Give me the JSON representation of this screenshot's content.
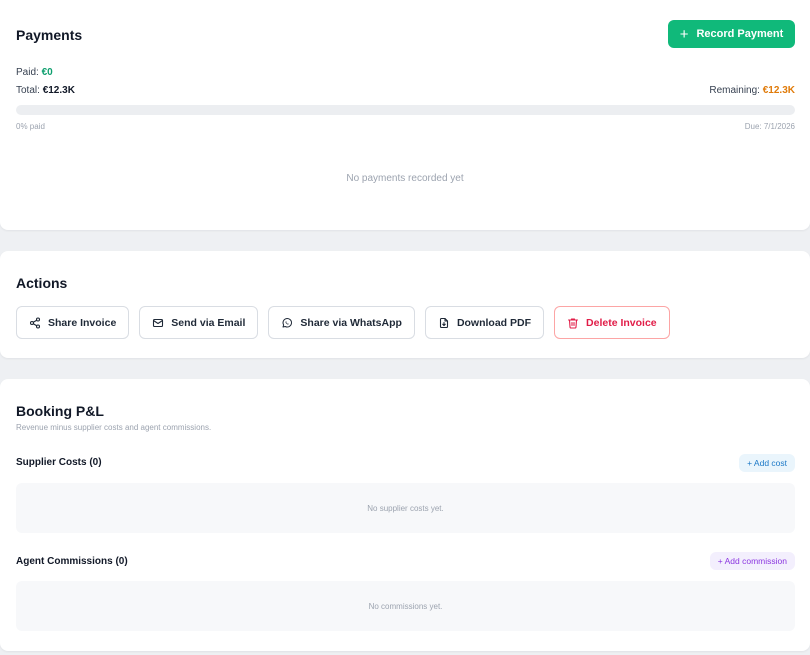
{
  "payments": {
    "title": "Payments",
    "record_button_label": "Record Payment",
    "paid_label": "Paid:",
    "paid_value": "€0",
    "total_label": "Total:",
    "total_value": "€12.3K",
    "remaining_label": "Remaining:",
    "remaining_value": "€12.3K",
    "progress_fraction": 0,
    "percent_paid_text": "0% paid",
    "due_text": "Due: 7/1/2026",
    "empty_text": "No payments recorded yet"
  },
  "actions": {
    "title": "Actions",
    "buttons": [
      {
        "label": "Share Invoice",
        "icon": "share-icon"
      },
      {
        "label": "Send via Email",
        "icon": "mail-icon"
      },
      {
        "label": "Share via WhatsApp",
        "icon": "whatsapp-icon"
      },
      {
        "label": "Download PDF",
        "icon": "file-download-icon"
      },
      {
        "label": "Delete Invoice",
        "icon": "trash-icon"
      }
    ]
  },
  "pnl": {
    "title": "Booking P&L",
    "subtitle": "Revenue minus supplier costs and agent commissions.",
    "supplier": {
      "heading": "Supplier Costs (0)",
      "add_label": "+ Add cost",
      "empty_text": "No supplier costs yet."
    },
    "commissions": {
      "heading": "Agent Commissions (0)",
      "add_label": "+ Add commission",
      "empty_text": "No commissions yet."
    }
  },
  "colors": {
    "primary_green": "#10b97a",
    "remaining_orange": "#e07b0a",
    "danger_red": "#e11d48",
    "link_blue": "#1d79c7",
    "link_purple": "#8b36e0"
  }
}
